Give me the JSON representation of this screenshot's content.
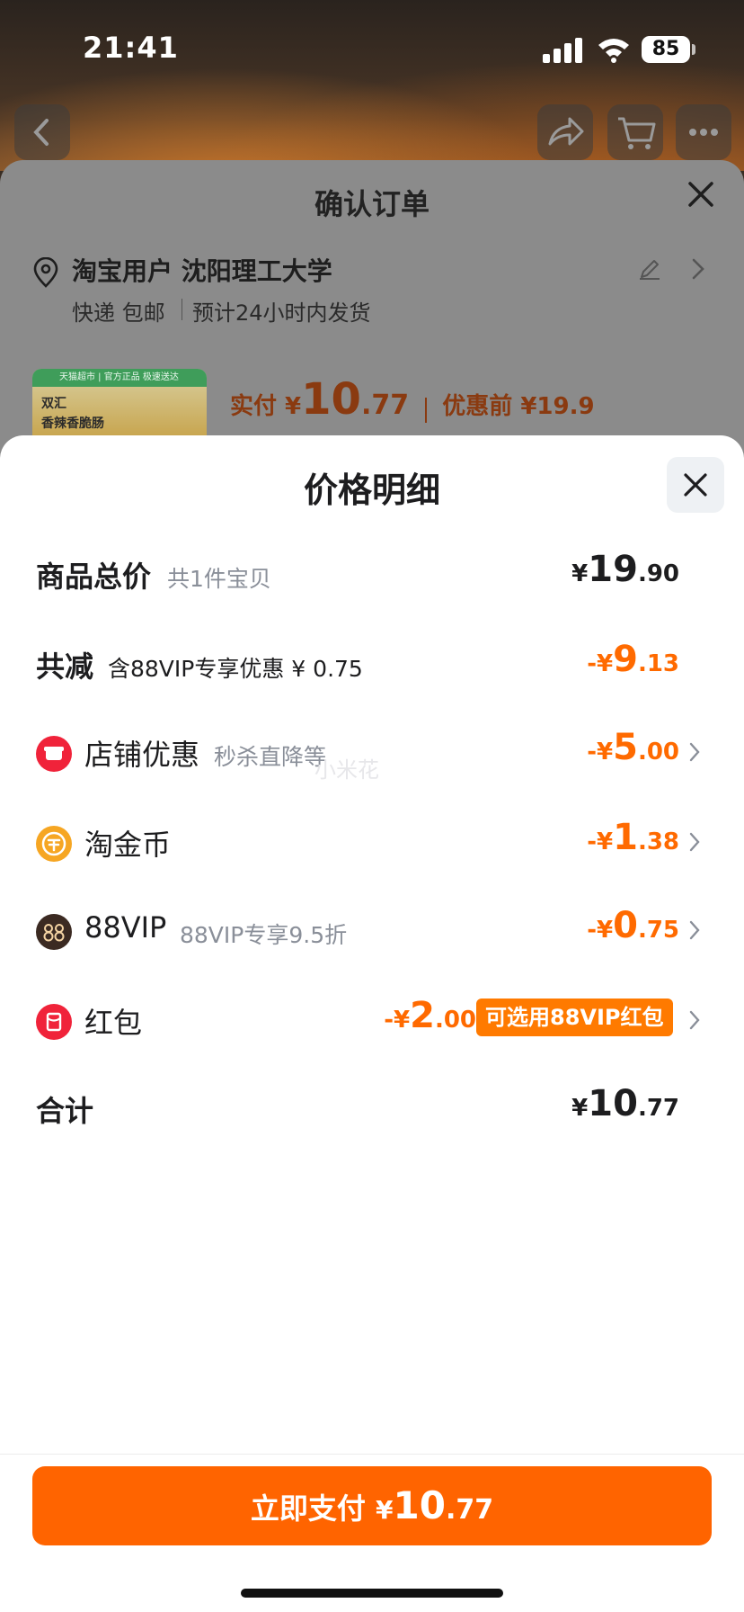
{
  "status_bar": {
    "time": "21:41",
    "battery": "85"
  },
  "confirm_order": {
    "title": "确认订单",
    "address": "淘宝用户 沈阳理工大学",
    "shipping": "快递 包邮",
    "eta": "预计24小时内发货",
    "thumb_banner": "天猫超市 | 官方正品 极速送达",
    "thumb_line1": "双汇",
    "thumb_line2": "香辣香脆肠",
    "paid_label": "实付 ¥",
    "paid_int": "10",
    "paid_dec": ".77",
    "before_label": "优惠前 ¥19.9"
  },
  "price_detail": {
    "title": "价格明细",
    "rows": [
      {
        "label": "商品总价",
        "sub": "共1件宝贝",
        "currency": "¥",
        "int": "19",
        "dec": ".90"
      },
      {
        "label": "共减",
        "sub": "含88VIP专享优惠 ¥ 0.75",
        "currency": "-¥",
        "int": "9",
        "dec": ".13"
      },
      {
        "label": "店铺优惠",
        "sub": "秒杀直降等",
        "currency": "-¥",
        "int": "5",
        "dec": ".00"
      },
      {
        "label": "淘金币",
        "sub": "",
        "currency": "-¥",
        "int": "1",
        "dec": ".38"
      },
      {
        "label": "88VIP",
        "sub": "88VIP专享9.5折",
        "currency": "-¥",
        "int": "0",
        "dec": ".75"
      },
      {
        "label": "红包",
        "sub": "",
        "currency": "-¥",
        "int": "2",
        "dec": ".00",
        "tag": "可选用88VIP红包"
      },
      {
        "label": "合计",
        "sub": "",
        "currency": "¥",
        "int": "10",
        "dec": ".77"
      }
    ],
    "watermark": "小米花"
  },
  "pay_button": {
    "label": "立即支付 ",
    "currency": "¥",
    "int": "10",
    "dec": ".77"
  },
  "colors": {
    "accent": "#ff6400",
    "discount": "#ff6a00",
    "vip_icon": "#3b2a22",
    "red_icon": "#f0233a",
    "coin_icon": "#f6a623"
  }
}
